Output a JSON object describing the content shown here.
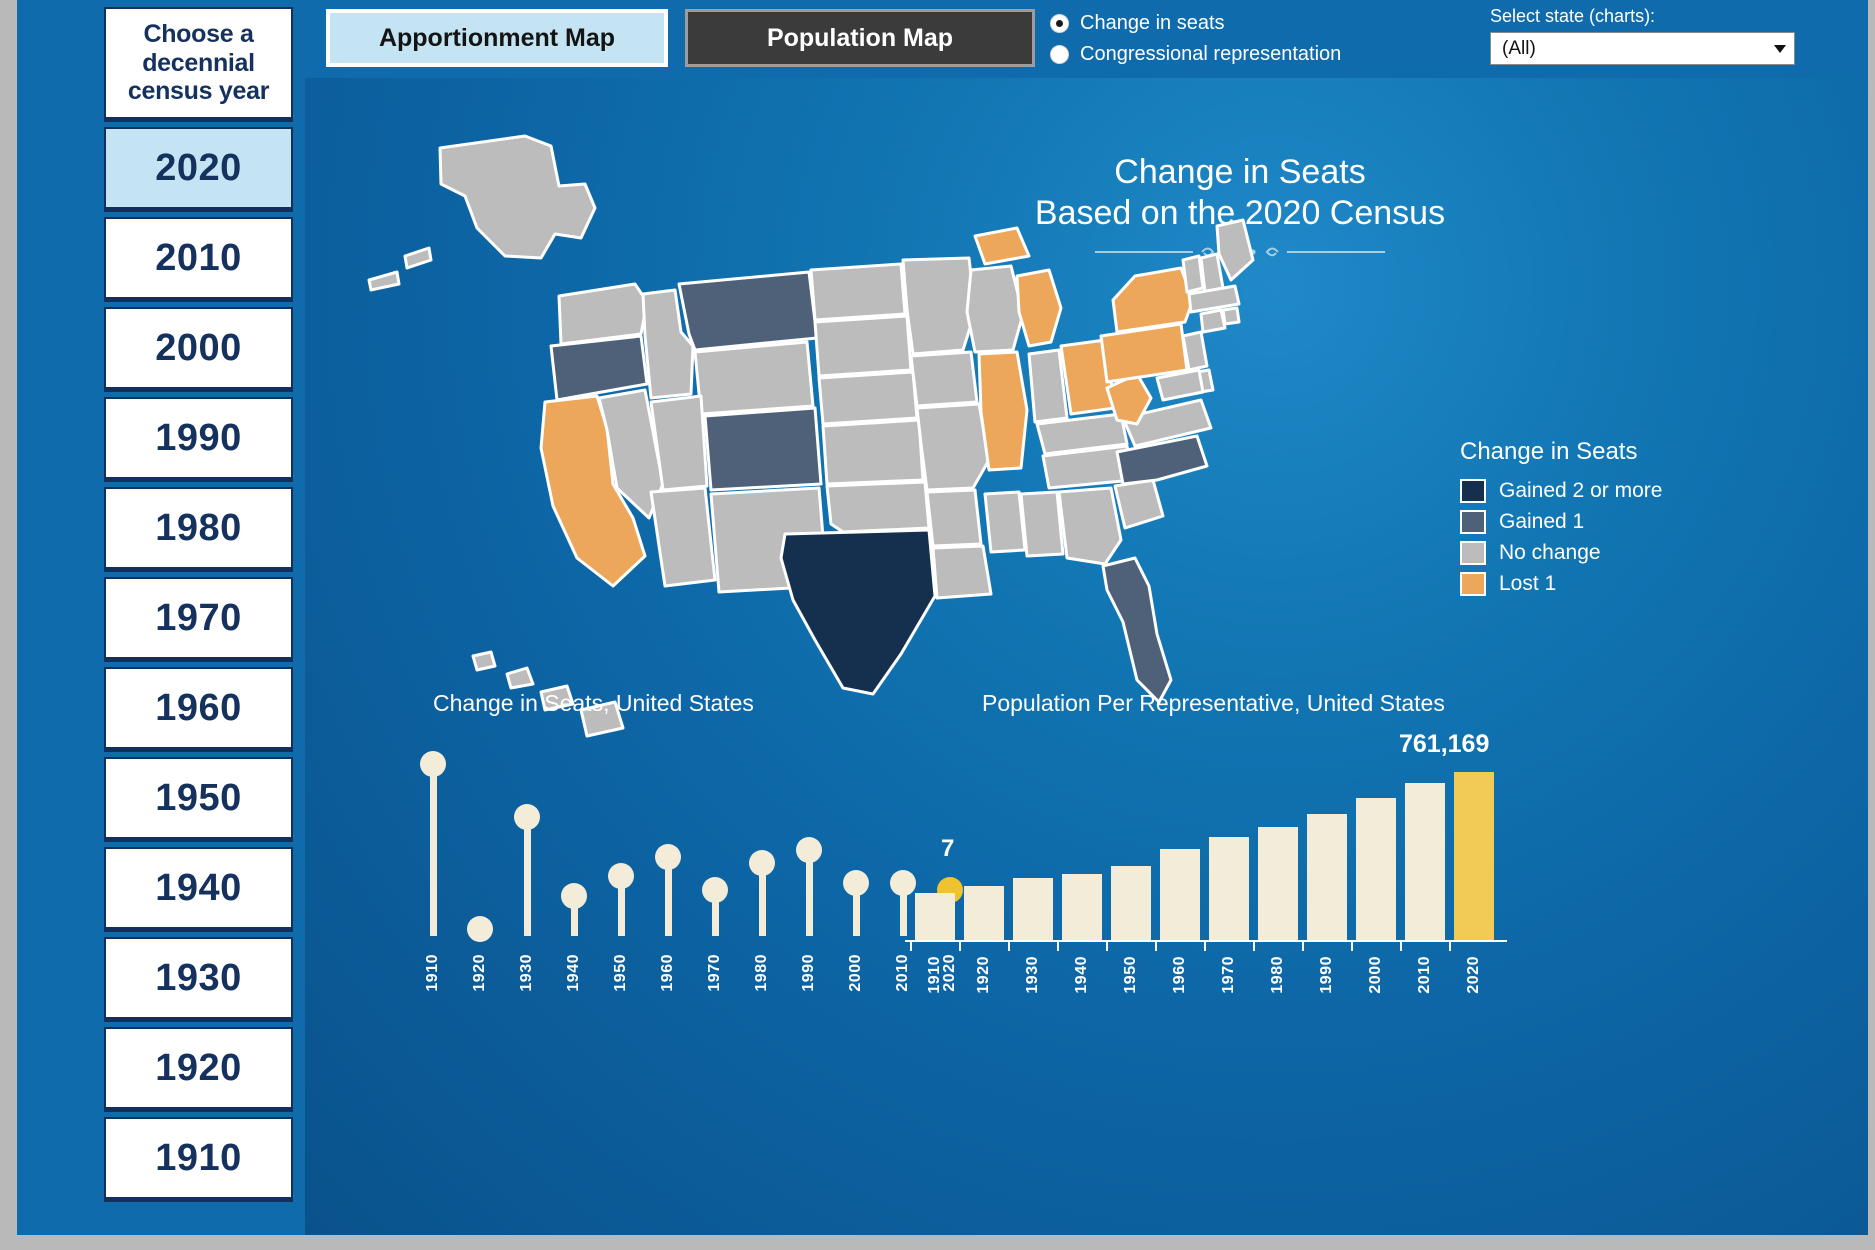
{
  "sidebar": {
    "header_lines": [
      "Choose a",
      "decennial",
      "census year"
    ],
    "years": [
      "2020",
      "2010",
      "2000",
      "1990",
      "1980",
      "1970",
      "1960",
      "1950",
      "1940",
      "1930",
      "1920",
      "1910"
    ],
    "selected_year": "2020"
  },
  "toolbar": {
    "tab_apportionment": "Apportionment Map",
    "tab_population": "Population Map",
    "active_tab": "Apportionment Map",
    "radios": [
      {
        "label": "Change in seats",
        "selected": true
      },
      {
        "label": "Congressional representation",
        "selected": false
      }
    ],
    "select_label": "Select state (charts):",
    "select_value": "(All)"
  },
  "map": {
    "title_line1": "Change in Seats",
    "title_line2": "Based on the 2020 Census",
    "legend_title": "Change in Seats",
    "legend": [
      {
        "label": "Gained 2 or more",
        "color": "#15304f"
      },
      {
        "label": "Gained 1",
        "color": "#4e6party"
      },
      {
        "label": "No change",
        "color": "#bcbcbc"
      },
      {
        "label": "Lost 1",
        "color": "#eda75a"
      }
    ],
    "colors": {
      "gained2": "#15304f",
      "gained1": "#4e6179",
      "nochange": "#bcbcbc",
      "lost1": "#eda75a",
      "border": "#ffffff"
    },
    "states_gained2": [
      "TX"
    ],
    "states_gained1": [
      "OR",
      "MT",
      "CO",
      "FL",
      "NC"
    ],
    "states_lost1": [
      "CA",
      "MI",
      "IL",
      "OH",
      "PA",
      "NY",
      "WV"
    ]
  },
  "chart_data": [
    {
      "type": "bar",
      "chart_style": "lollipop",
      "title": "Change in Seats, United States",
      "categories": [
        "1910",
        "1920",
        "1930",
        "1940",
        "1950",
        "1960",
        "1970",
        "1980",
        "1990",
        "2000",
        "2010",
        "2020"
      ],
      "values": [
        26,
        1,
        18,
        6,
        9,
        12,
        7,
        11,
        13,
        8,
        8,
        7
      ],
      "highlight_index": 11,
      "highlight_color": "#efc231",
      "series_color": "#f2ecd9",
      "data_label": "7",
      "data_label_index": 11,
      "xlabel": "",
      "ylabel": "",
      "grid": false
    },
    {
      "type": "bar",
      "title": "Population Per Representative, United States",
      "categories": [
        "1910",
        "1920",
        "1930",
        "1940",
        "1950",
        "1960",
        "1970",
        "1980",
        "1990",
        "2000",
        "2010",
        "2020"
      ],
      "values": [
        211877,
        243728,
        280675,
        301164,
        334587,
        410481,
        465329,
        510818,
        571477,
        645632,
        709760,
        761169
      ],
      "highlight_index": 11,
      "highlight_color": "#f1cb55",
      "series_color": "#f2ecd9",
      "data_label": "761,169",
      "data_label_index": 11,
      "xlabel": "",
      "ylabel": "",
      "grid": false
    }
  ]
}
